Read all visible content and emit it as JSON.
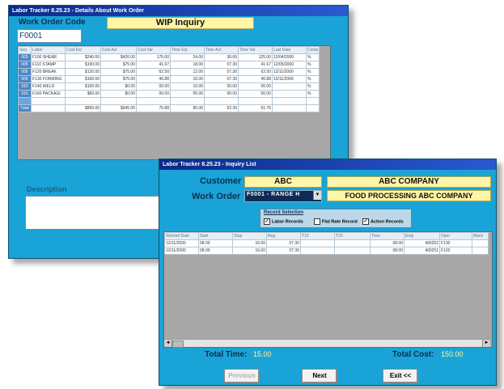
{
  "win1": {
    "title": "Labor Tracker 8.25.23 - Details About Work Order",
    "work_order_label": "Work Order Code",
    "work_order_value": "F0001",
    "banner": "WIP Inquiry",
    "description_label": "Description",
    "grid": {
      "headers": [
        "Seq",
        "Labor",
        "Cost Est",
        "Cost Act",
        "Cost Var",
        "Time Est",
        "Time Act",
        "Time Var",
        "Last Date",
        "Comp"
      ],
      "rows": [
        [
          "005",
          "F100 SHEAR",
          "$240.00",
          "$420.00",
          "175.00",
          "24.00",
          "30.00",
          "125.00",
          "12/04/2000",
          "%"
        ],
        [
          "005",
          "F110 STAMP",
          "$100.00",
          "$75.00",
          "41.67",
          "18.00",
          "07.30",
          "41.67",
          "12/05/2000",
          "%"
        ],
        [
          "005",
          "F120 BREAK",
          "$120.00",
          "$75.00",
          "62.50",
          "12.00",
          "07.30",
          "62.50",
          "12/11/2000",
          "%"
        ],
        [
          "005",
          "F130 FORMING",
          "$160.00",
          "$75.00",
          "46.88",
          "16.00",
          "07.30",
          "46.88",
          "12/11/2000",
          "%"
        ],
        [
          "010",
          "F140 WELD",
          "$100.00",
          "$0.00",
          "00.00",
          "10.00",
          "00.00",
          "00.00",
          "",
          "%"
        ],
        [
          "015",
          "F160 PACKAGI",
          "$50.00",
          "$0.00",
          "00.00",
          "05.00",
          "00.00",
          "00.00",
          "",
          "%"
        ],
        [
          "",
          "",
          "",
          "",
          "",
          "",
          "",
          "",
          "",
          ""
        ],
        [
          "Total",
          "",
          "$850.00",
          "$645.00",
          "75.88",
          "85.00",
          "52.30",
          "61.76",
          "",
          ""
        ]
      ]
    }
  },
  "win2": {
    "title": "Labor Tracker 8.25.23 - Inquiry List",
    "customer_label": "Customer",
    "customer_code": "ABC",
    "customer_name": "ABC COMPANY",
    "work_order_label": "Work Order",
    "work_order_select": "F0001 - RANGE H",
    "work_order_name": "FOOD PROCESSING ABC COMPANY",
    "record_selection": {
      "title": "Record Selection",
      "labor": "Labor Records",
      "flat": "Flat Rate Record",
      "action": "Action Records"
    },
    "grid": {
      "headers": [
        "Worked Date",
        "Start",
        "Stop",
        "Reg",
        "T15",
        "T20",
        "Time",
        "Emp",
        "Oper",
        "Mach"
      ],
      "rows": [
        [
          "12/11/2000",
          "08.00",
          "16.00",
          "07.30",
          "",
          "",
          "08.00",
          "400252",
          "F130",
          ""
        ],
        [
          "12/11/2000",
          "08.00",
          "16.00",
          "07.30",
          "",
          "",
          "08.00",
          "400251",
          "F120",
          ""
        ]
      ]
    },
    "total_time_label": "Total Time:",
    "total_time_value": "15.00",
    "total_cost_label": "Total Cost:",
    "total_cost_value": "150.00",
    "buttons": {
      "previous": "Previous",
      "next": "Next",
      "exit": "Exit <<"
    }
  }
}
